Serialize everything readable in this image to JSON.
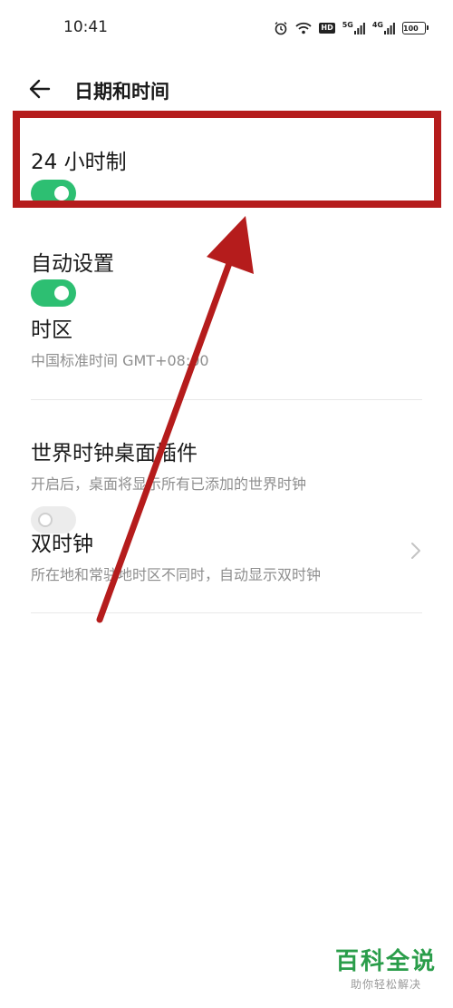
{
  "status_bar": {
    "time": "10:41",
    "hd_badge": "HD",
    "net1": "5G",
    "net2": "4G",
    "battery": "100"
  },
  "header": {
    "title": "日期和时间",
    "back_icon": "back-arrow-icon"
  },
  "settings": {
    "hour24": {
      "title": "24 小时制",
      "enabled": true
    },
    "auto_set": {
      "title": "自动设置",
      "enabled": true
    },
    "timezone": {
      "title": "时区",
      "subtitle": "中国标准时间 GMT+08:00"
    },
    "world_clock": {
      "title": "世界时钟桌面插件",
      "subtitle": "开启后，桌面将显示所有已添加的世界时钟",
      "enabled": false
    },
    "dual_clock": {
      "title": "双时钟",
      "subtitle": "所在地和常驻地时区不同时，自动显示双时钟"
    }
  },
  "colors": {
    "toggle_on": "#2dbf72",
    "toggle_off": "#ececec",
    "annotation_red": "#b51c1c",
    "watermark_green": "#2a9d4a"
  },
  "watermark": {
    "title": "百科全说",
    "subtitle": "助你轻松解决"
  }
}
